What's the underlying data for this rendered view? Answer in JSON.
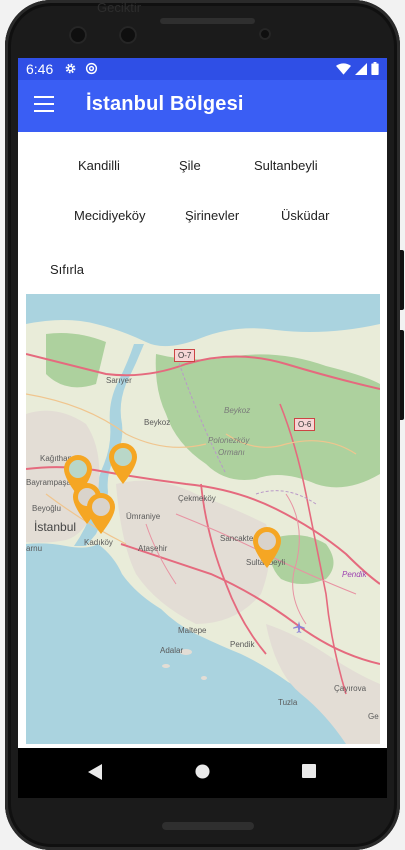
{
  "device": {
    "top_bleed_text": "Geciktir"
  },
  "statusbar": {
    "time": "6:46",
    "left_icons": [
      "gear-icon",
      "at-icon"
    ],
    "right_icons": [
      "wifi-icon",
      "signal-icon",
      "battery-icon"
    ]
  },
  "appbar": {
    "title": "İstanbul Bölgesi",
    "menu_icon": "menu-icon"
  },
  "filters": {
    "chips": [
      "Kandilli",
      "Şile",
      "Sultanbeyli",
      "Mecidiyeköy",
      "Şirinevler",
      "Üsküdar"
    ],
    "reset_label": "Sıfırla"
  },
  "map": {
    "labels": {
      "sariyer": "Sarıyer",
      "beykoz_town": "Beykoz",
      "beykoz_district": "Beykoz",
      "polonezkoy": "Polonezköy",
      "ormani": "Ormanı",
      "kagithane": "Kağıthane",
      "bayrampasa": "Bayrampaşa",
      "beyoglu": "Beyoğlu",
      "istanbul": "İstanbul",
      "arnu": "arnu",
      "kadikoy": "Kadıköy",
      "umraniye": "Ümraniye",
      "atasehir": "Ataşehir",
      "cekmekoy": "Çekmeköy",
      "sancaktepe": "Sancaktepe",
      "sultanbeyli": "Sultanbeyli",
      "pendik_district": "Pendik",
      "pendik": "Pendik",
      "maltepe": "Maltepe",
      "adalar": "Adalar",
      "tuzla": "Tuzla",
      "cayirova": "Çayırova",
      "ge": "Ge"
    },
    "shields": {
      "o7": "O-7",
      "o6": "O-6"
    },
    "marker_color": "#f5a623",
    "marker_count": 5
  },
  "colors": {
    "appbar": "#3a5ef4",
    "statusbar": "#2f4fe6",
    "water": "#aad3df",
    "land": "#e9ecd9",
    "forest": "#add19e",
    "road": "#e892a2",
    "motorway": "#e56a7e"
  },
  "navbar": {
    "icons": [
      "back-triangle-icon",
      "home-circle-icon",
      "recents-square-icon"
    ]
  }
}
